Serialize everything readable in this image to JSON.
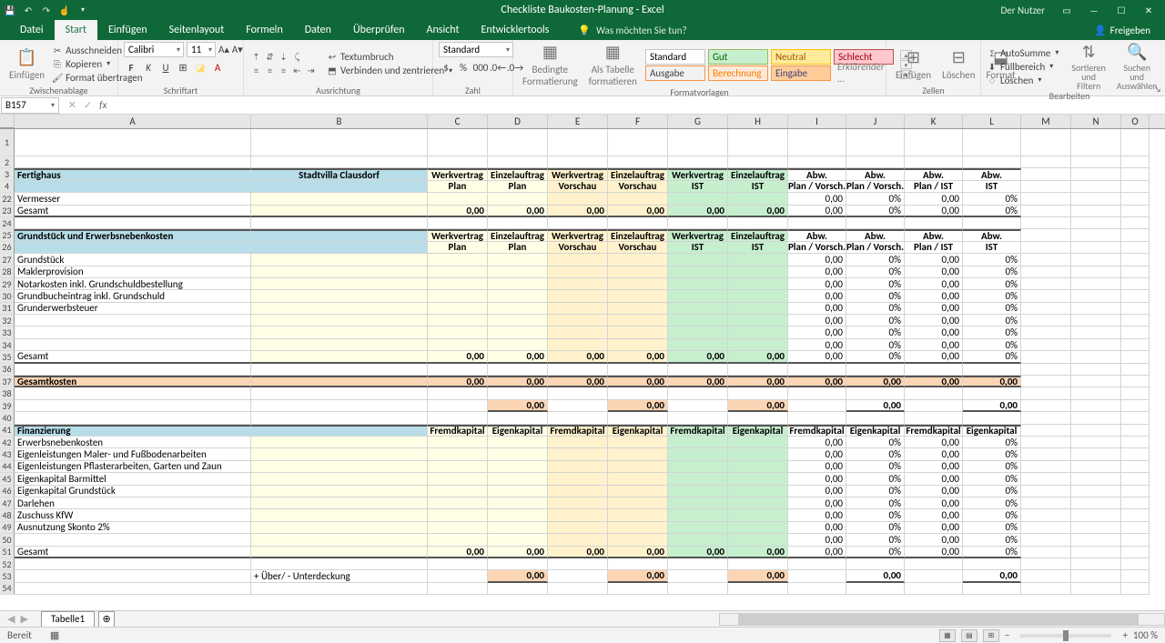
{
  "titlebar": {
    "doc": "Checkliste Baukosten-Planung - Excel",
    "user": "Der Nutzer"
  },
  "tabs": [
    "Datei",
    "Start",
    "Einfügen",
    "Seitenlayout",
    "Formeln",
    "Daten",
    "Überprüfen",
    "Ansicht",
    "Entwicklertools"
  ],
  "tell": "Was möchten Sie tun?",
  "share": "Freigeben",
  "clipboard": {
    "paste": "Einfügen",
    "cut": "Ausschneiden",
    "copy": "Kopieren",
    "format": "Format übertragen",
    "group": "Zwischenablage"
  },
  "font": {
    "name": "Calibri",
    "size": "11",
    "group": "Schriftart"
  },
  "align": {
    "wrap": "Textumbruch",
    "merge": "Verbinden und zentrieren",
    "group": "Ausrichtung"
  },
  "number": {
    "fmt": "Standard",
    "group": "Zahl"
  },
  "styles": {
    "cond": "Bedingte Formatierung",
    "table": "Als Tabelle formatieren",
    "group": "Formatvorlagen",
    "s": [
      "Standard",
      "Gut",
      "Neutral",
      "Schlecht",
      "Ausgabe",
      "Berechnung",
      "Eingabe",
      "Erklärender ..."
    ]
  },
  "cells": {
    "ins": "Einfügen",
    "del": "Löschen",
    "fmt": "Format",
    "group": "Zellen"
  },
  "editing": {
    "sum": "AutoSumme",
    "fill": "Füllbereich",
    "clear": "Löschen",
    "sort": "Sortieren und Filtern",
    "find": "Suchen und Auswählen",
    "group": "Bearbeiten"
  },
  "namebox": "B157",
  "formula": "",
  "cols": [
    "A",
    "B",
    "C",
    "D",
    "E",
    "F",
    "G",
    "H",
    "I",
    "J",
    "K",
    "L",
    "M",
    "N",
    "O"
  ],
  "firstRow": 1,
  "hdr_wp": "Werkvertrag",
  "hdr_ea": "Einzelauftrag",
  "hdr_plan": "Plan",
  "hdr_vor": "Vorschau",
  "hdr_ist": "IST",
  "hdr_abwI": "Abw.",
  "hdr_pv": "Plan / Vorsch.",
  "hdr_pi": "Plan / IST",
  "hdr_ist2": "IST",
  "hdr_fk": "Fremdkapital",
  "hdr_ek": "Eigenkapital",
  "s1": {
    "t": "Fertighaus",
    "sub": "Stadtvilla Clausdorf",
    "rows": [
      "Vermesser"
    ],
    "sum": "Gesamt"
  },
  "s2": {
    "t": "Grundstück und Erwerbsnebenkosten",
    "rows": [
      "Grundstück",
      "Maklerprovision",
      "Notarkosten inkl. Grundschuldbestellung",
      "Grundbucheintrag inkl. Grundschuld",
      "Grunderwerbsteuer",
      "",
      "",
      ""
    ],
    "sum": "Gesamt"
  },
  "gk": "Gesamtkosten",
  "s3": {
    "t": "Finanzierung",
    "rows": [
      "Erwerbsnebenkosten",
      "Eigenleistungen Maler- und Fußbodenarbeiten",
      "Eigenleistungen Pflasterarbeiten, Garten und Zaun",
      "Eigenkapital Barmittel",
      "Eigenkapital Grundstück",
      "Darlehen",
      "Zuschuss KfW",
      "Ausnutzung Skonto 2%",
      ""
    ],
    "sum": "Gesamt"
  },
  "ueber": "+ Über/ - Unterdeckung",
  "v0": "0,00",
  "p0": "0%",
  "sheet": "Tabelle1",
  "status": "Bereit",
  "zoom": "100 %"
}
